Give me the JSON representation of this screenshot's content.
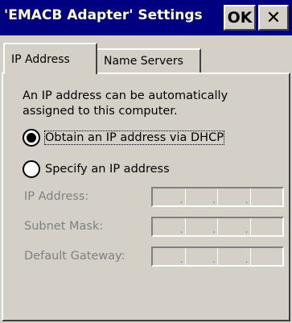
{
  "window": {
    "title": "'EMACB Adapter' Settings",
    "ok_label": "OK",
    "close_label": "✕"
  },
  "tabs": [
    {
      "label": "IP Address",
      "active": true
    },
    {
      "label": "Name Servers",
      "active": false
    }
  ],
  "panel": {
    "description": "An IP address can be automatically assigned to this computer.",
    "options": [
      {
        "label": "Obtain an IP address via DHCP",
        "checked": true
      },
      {
        "label": "Specify an IP address",
        "checked": false
      }
    ],
    "fields": [
      {
        "label": "IP Address:",
        "value": ""
      },
      {
        "label": "Subnet Mask:",
        "value": ""
      },
      {
        "label": "Default Gateway:",
        "value": ""
      }
    ]
  },
  "colors": {
    "titlebar": "#000080",
    "face": "#d4d0c8",
    "disabled_text": "#808080"
  }
}
